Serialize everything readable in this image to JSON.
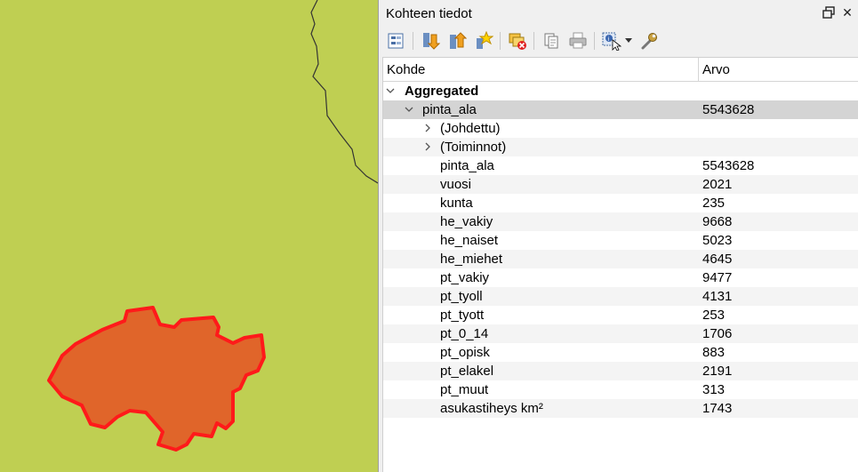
{
  "panel": {
    "title": "Kohteen tiedot",
    "toolbar": [
      {
        "icon": "expand-tree-icon",
        "label": "Expand tree"
      },
      {
        "icon": "expand-all-icon",
        "label": "Expand all"
      },
      {
        "icon": "collapse-all-icon",
        "label": "Collapse all"
      },
      {
        "icon": "highlight-icon",
        "label": "Highlight"
      },
      {
        "icon": "clear-results-icon",
        "label": "Clear results"
      },
      {
        "icon": "copy-icon",
        "label": "Copy"
      },
      {
        "icon": "print-icon",
        "label": "Print"
      },
      {
        "icon": "identify-mode-icon",
        "label": "Identify mode"
      },
      {
        "icon": "settings-wrench-icon",
        "label": "Settings"
      }
    ]
  },
  "tree": {
    "columns": [
      "Kohde",
      "Arvo"
    ],
    "root": {
      "label": "Aggregated"
    },
    "feature": {
      "label": "pinta_ala",
      "value": "5543628"
    },
    "groups": [
      "(Johdettu)",
      "(Toiminnot)"
    ],
    "attributes": [
      {
        "name": "pinta_ala",
        "value": "5543628"
      },
      {
        "name": "vuosi",
        "value": "2021"
      },
      {
        "name": "kunta",
        "value": "235"
      },
      {
        "name": "he_vakiy",
        "value": "9668"
      },
      {
        "name": "he_naiset",
        "value": "5023"
      },
      {
        "name": "he_miehet",
        "value": "4645"
      },
      {
        "name": "pt_vakiy",
        "value": "9477"
      },
      {
        "name": "pt_tyoll",
        "value": "4131"
      },
      {
        "name": "pt_tyott",
        "value": "253"
      },
      {
        "name": "pt_0_14",
        "value": "1706"
      },
      {
        "name": "pt_opisk",
        "value": "883"
      },
      {
        "name": "pt_elakel",
        "value": "2191"
      },
      {
        "name": "pt_muut",
        "value": "313"
      },
      {
        "name": "asukastiheys km²",
        "value": "1743"
      }
    ]
  },
  "colors": {
    "map_background": "#bfcf52",
    "feature_fill": "#e0652a",
    "feature_outline": "#ff1a1a",
    "boundary_line": "#333333"
  }
}
